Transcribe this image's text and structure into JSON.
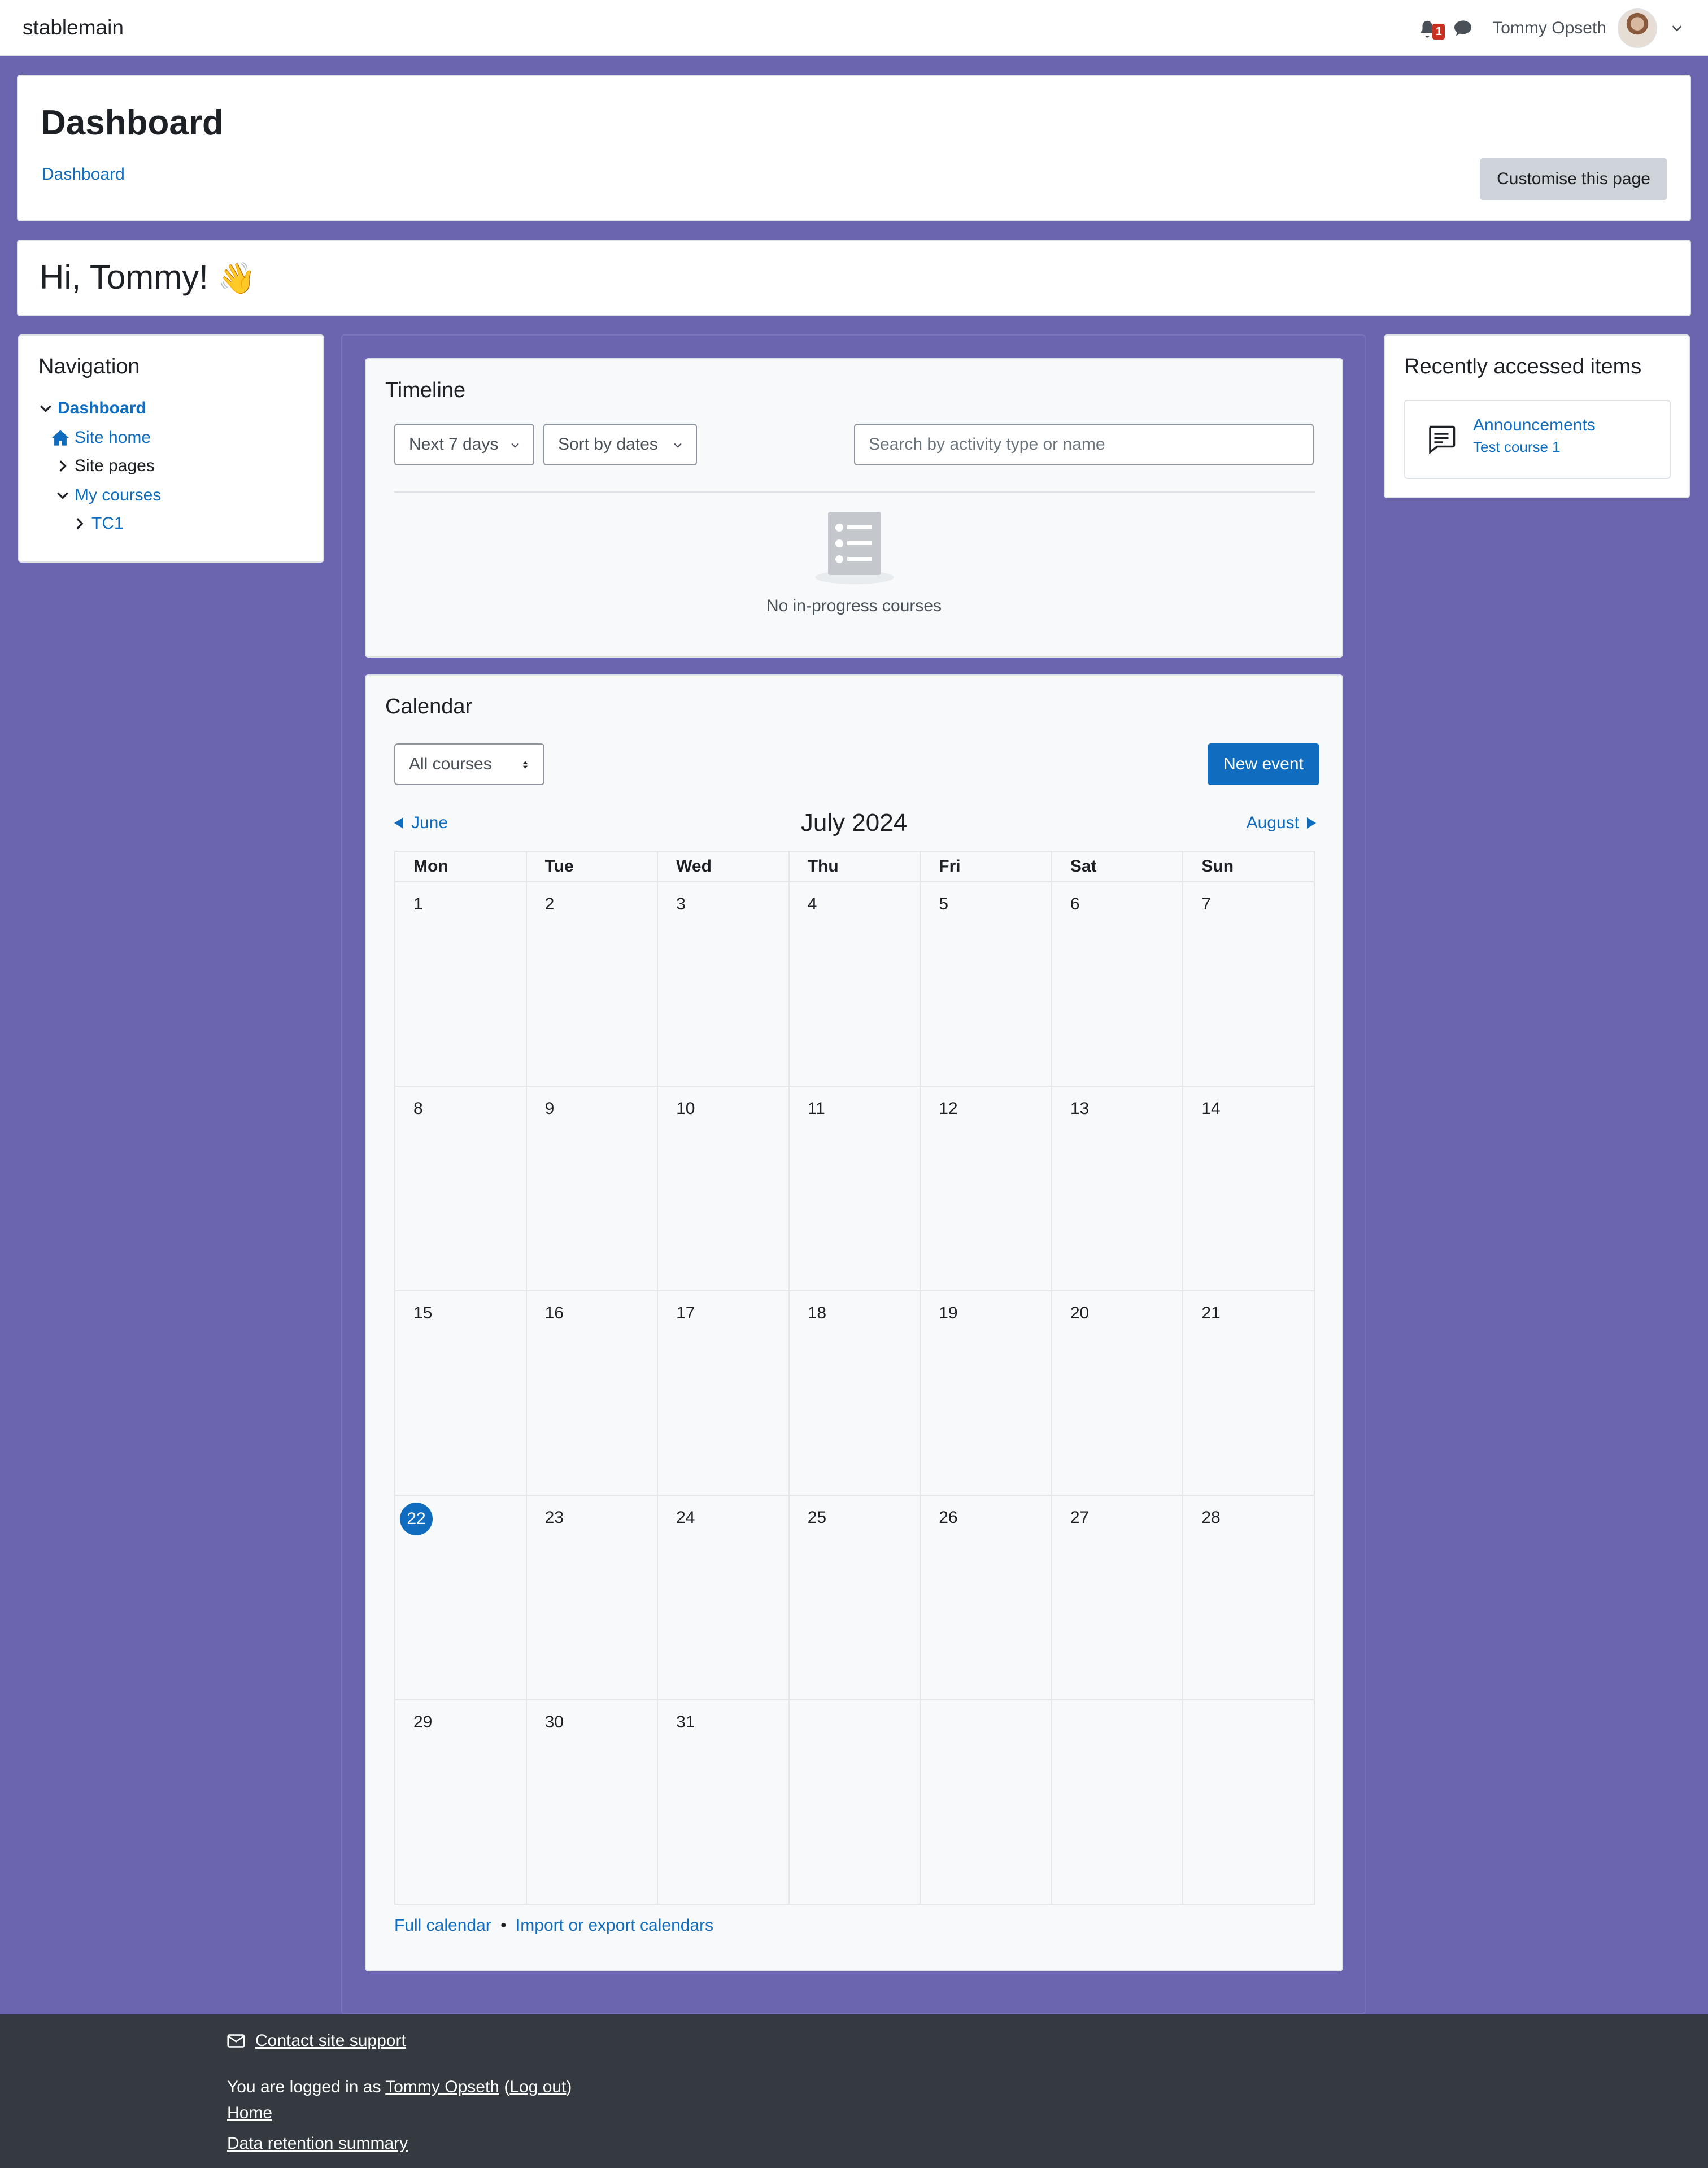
{
  "navbar": {
    "brand": "stablemain",
    "notification_count": "1",
    "user_name": "Tommy Opseth"
  },
  "header": {
    "title": "Dashboard",
    "breadcrumb": "Dashboard",
    "customise_button": "Customise this page"
  },
  "greeting": {
    "text": "Hi, Tommy!",
    "emoji": "👋"
  },
  "navigation": {
    "title": "Navigation",
    "items": [
      {
        "label": "Dashboard"
      },
      {
        "label": "Site home"
      },
      {
        "label": "Site pages"
      },
      {
        "label": "My courses"
      },
      {
        "label": "TC1"
      }
    ]
  },
  "recent": {
    "title": "Recently accessed items",
    "item_title": "Announcements",
    "item_course": "Test course 1"
  },
  "timeline": {
    "title": "Timeline",
    "filter_days": "Next 7 days",
    "sort": "Sort by dates",
    "search_placeholder": "Search by activity type or name",
    "empty_text": "No in-progress courses"
  },
  "calendar": {
    "title": "Calendar",
    "course_filter": "All courses",
    "new_event": "New event",
    "month": "July 2024",
    "prev_month": "June",
    "next_month": "August",
    "weekdays": [
      "Mon",
      "Tue",
      "Wed",
      "Thu",
      "Fri",
      "Sat",
      "Sun"
    ],
    "weeks": [
      [
        "1",
        "2",
        "3",
        "4",
        "5",
        "6",
        "7"
      ],
      [
        "8",
        "9",
        "10",
        "11",
        "12",
        "13",
        "14"
      ],
      [
        "15",
        "16",
        "17",
        "18",
        "19",
        "20",
        "21"
      ],
      [
        "22",
        "23",
        "24",
        "25",
        "26",
        "27",
        "28"
      ],
      [
        "29",
        "30",
        "31",
        "",
        "",
        "",
        ""
      ]
    ],
    "today": "22",
    "full_calendar": "Full calendar",
    "separator": "•",
    "import_export": "Import or export calendars"
  },
  "footer": {
    "contact": "Contact site support",
    "logged_in_prefix": "You are logged in as",
    "logged_in_user": "Tommy Opseth",
    "logout": "Log out",
    "home": "Home",
    "data_retention": "Data retention summary"
  },
  "colors": {
    "page_bg": "#6b65b0",
    "accent": "#0f6cbf",
    "footer_bg": "#343a40",
    "badge": "#ca3120"
  }
}
